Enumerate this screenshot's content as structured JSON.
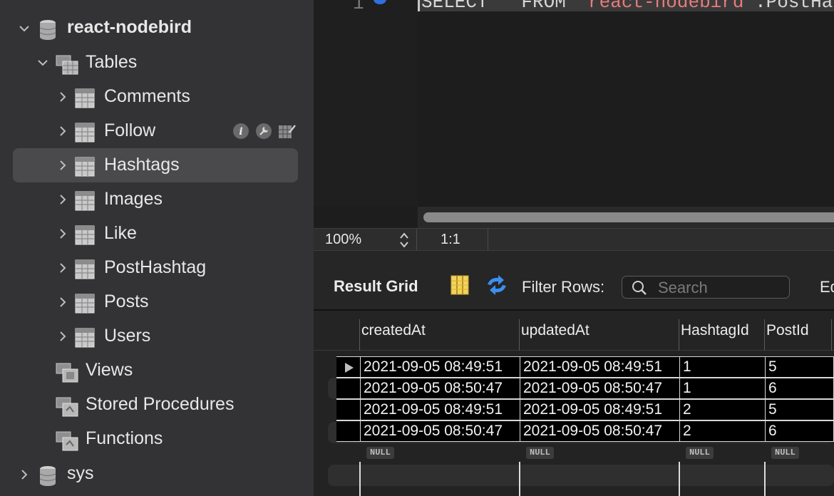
{
  "sidebar": {
    "schemas": [
      {
        "label": "react-nodebird",
        "expanded": true
      },
      {
        "label": "sys",
        "expanded": false
      }
    ],
    "tables_folder": "Tables",
    "tables": [
      "Comments",
      "Follow",
      "Hashtags",
      "Images",
      "Like",
      "PostHashtag",
      "Posts",
      "Users"
    ],
    "selected_table": "Hashtags",
    "hovered_table": "Follow",
    "other_folders": [
      "Views",
      "Stored Procedures",
      "Functions"
    ],
    "hover_tool_icons": [
      "info-icon",
      "wrench-icon",
      "table-edit-icon"
    ]
  },
  "editor": {
    "line_number": "1",
    "code_keyword_select": "SELECT * FROM ",
    "code_schema": "`react-nodebird`",
    "code_table": ".PostHa"
  },
  "statusbar": {
    "zoom": "100%",
    "cursor_position": "1:1"
  },
  "result_toolbar": {
    "result_grid_label": "Result Grid",
    "filter_rows_label": "Filter Rows:",
    "search_placeholder": "Search",
    "edit_label": "Ed"
  },
  "grid": {
    "columns": [
      "createdAt",
      "updatedAt",
      "HashtagId",
      "PostId"
    ],
    "rows": [
      [
        "2021-09-05 08:49:51",
        "2021-09-05 08:49:51",
        "1",
        "5"
      ],
      [
        "2021-09-05 08:50:47",
        "2021-09-05 08:50:47",
        "1",
        "6"
      ],
      [
        "2021-09-05 08:49:51",
        "2021-09-05 08:49:51",
        "2",
        "5"
      ],
      [
        "2021-09-05 08:50:47",
        "2021-09-05 08:50:47",
        "2",
        "6"
      ]
    ],
    "null_label": "NULL"
  },
  "colors": {
    "sidebar_bg": "#333234",
    "selected_row": "#4a494c",
    "editor_bg": "#1d1d1d",
    "string_literal": "#e97b7b",
    "exec_marker": "#2f6fe0"
  }
}
